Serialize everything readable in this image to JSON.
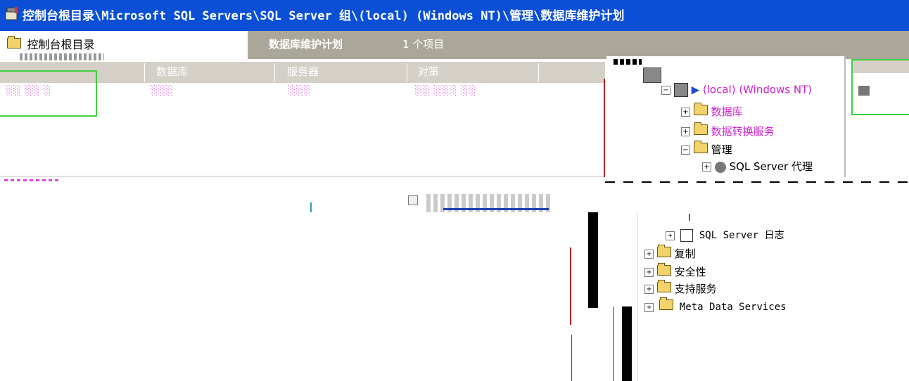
{
  "window": {
    "title": "控制台根目录\\Microsoft SQL Servers\\SQL Server 组\\(local) (Windows NT)\\管理\\数据库维护计划"
  },
  "left_tree": {
    "root_label": "控制台根目录"
  },
  "header": {
    "section_title": "数据库维护计划",
    "item_count": "1 个项目"
  },
  "columns": [
    "数据库",
    "服务器",
    "对策"
  ],
  "right_tree": {
    "local_server": "(local) (Windows NT)",
    "databases": "数据库",
    "data_transformation": "数据转换服务",
    "management": "管理",
    "sql_agent": "SQL Server 代理",
    "sql_logs": "SQL Server 日志",
    "replication": "复制",
    "security": "安全性",
    "support_services": "支持服务",
    "meta_data": "Meta Data Services"
  },
  "colors": {
    "titlebar": "#0a4fd6",
    "header_strip": "#aaa79a"
  }
}
